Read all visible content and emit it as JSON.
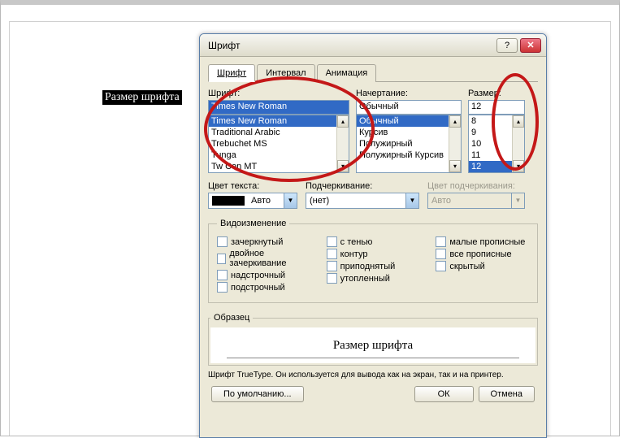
{
  "doc": {
    "selected_text": "Размер шрифта"
  },
  "dialog": {
    "title": "Шрифт",
    "tabs": {
      "font": "Шрифт",
      "spacing": "Интервал",
      "animation": "Анимация"
    },
    "labels": {
      "font": "Шрифт:",
      "style": "Начертание:",
      "size": "Размер:",
      "color": "Цвет текста:",
      "underline": "Подчеркивание:",
      "underline_color": "Цвет подчеркивания:"
    },
    "font": {
      "value": "Times New Roman",
      "options": [
        "Times New Roman",
        "Traditional Arabic",
        "Trebuchet MS",
        "Tunga",
        "Tw Cen MT"
      ]
    },
    "style": {
      "value": "Обычный",
      "options": [
        "Обычный",
        "Курсив",
        "Полужирный",
        "Полужирный Курсив"
      ]
    },
    "size": {
      "value": "12",
      "options": [
        "8",
        "9",
        "10",
        "11",
        "12"
      ]
    },
    "color": {
      "value": "Авто"
    },
    "underline": {
      "value": "(нет)"
    },
    "underline_color": {
      "value": "Авто"
    },
    "effects": {
      "legend": "Видоизменение",
      "col1": [
        "зачеркнутый",
        "двойное зачеркивание",
        "надстрочный",
        "подстрочный"
      ],
      "col2": [
        "с тенью",
        "контур",
        "приподнятый",
        "утопленный"
      ],
      "col3": [
        "малые прописные",
        "все прописные",
        "скрытый"
      ]
    },
    "preview": {
      "legend": "Образец",
      "text": "Размер шрифта"
    },
    "hint": "Шрифт TrueType. Он используется для вывода как на экран, так и на принтер.",
    "buttons": {
      "default": "По умолчанию...",
      "ok": "ОК",
      "cancel": "Отмена"
    }
  }
}
